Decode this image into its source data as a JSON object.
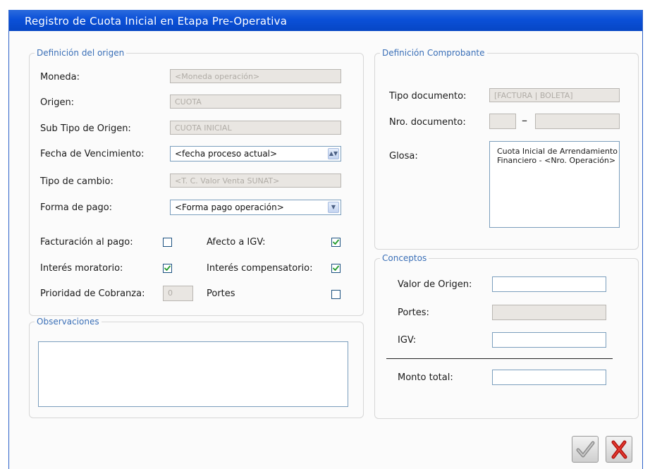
{
  "window": {
    "title": "Registro de Cuota Inicial en Etapa Pre-Operativa"
  },
  "origen": {
    "section_title": "Definición del origen",
    "moneda_label": "Moneda:",
    "moneda_value": "<Moneda operación>",
    "origen_label": "Origen:",
    "origen_value": "CUOTA",
    "subtipo_label": "Sub Tipo de Origen:",
    "subtipo_value": "CUOTA INICIAL",
    "fecha_label": "Fecha de Vencimiento:",
    "fecha_value": "<fecha proceso actual>",
    "tipocambio_label": "Tipo de cambio:",
    "tipocambio_value": "<T. C. Valor Venta SUNAT>",
    "formapago_label": "Forma de pago:",
    "formapago_value": "<Forma pago operación>",
    "facturacion_label": "Facturación al pago:",
    "facturacion_checked": false,
    "igv_label": "Afecto a IGV:",
    "igv_checked": true,
    "moratorio_label": "Interés moratorio:",
    "moratorio_checked": true,
    "compensatorio_label": "Interés compensatorio:",
    "compensatorio_checked": true,
    "prioridad_label": "Prioridad de Cobranza:",
    "prioridad_value": "0",
    "portes_label": "Portes",
    "portes_checked": false
  },
  "observaciones": {
    "section_title": "Observaciones"
  },
  "comprobante": {
    "section_title": "Definición Comprobante",
    "tipodoc_label": "Tipo documento:",
    "tipodoc_value": "[FACTURA | BOLETA]",
    "nrodoc_label": "Nro. documento:",
    "nrodoc_separator": "–",
    "glosa_label": "Glosa:",
    "glosa_value": "Cuota Inicial de Arrendamiento Financiero - <Nro. Operación>"
  },
  "conceptos": {
    "section_title": "Conceptos",
    "valor_label": "Valor de Origen:",
    "portes_label": "Portes:",
    "igv_label": "IGV:",
    "total_label": "Monto total:"
  },
  "actions": {
    "accept_icon": "check-icon",
    "cancel_icon": "x-icon"
  }
}
